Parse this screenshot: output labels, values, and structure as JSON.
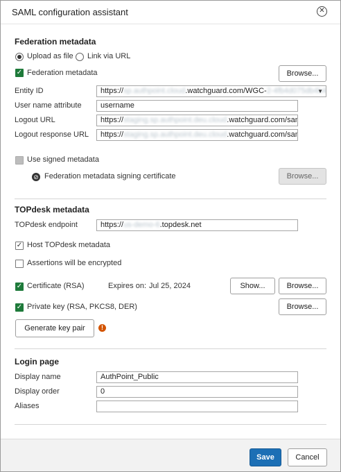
{
  "dialog": {
    "title": "SAML configuration assistant",
    "close_icon": "close-circle-icon"
  },
  "federation": {
    "section_title": "Federation metadata",
    "upload_label": "Upload as file",
    "link_label": "Link via URL",
    "metadata_checkbox_label": "Federation metadata",
    "browse_label": "Browse...",
    "entity_id_label": "Entity ID",
    "entity_id_prefix": "https://",
    "entity_id_blur1": "sp.authpoint.cloud",
    "entity_id_mid": ".watchguard.com/WGC-",
    "entity_id_blur2": "2-4fb4d075db4b4e",
    "username_attr_label": "User name attribute",
    "username_attr_value": "username",
    "logout_url_label": "Logout URL",
    "logout_url_prefix": "https://",
    "logout_url_blur": "staging.sp.authpoint.deu.cloud",
    "logout_url_suffix": ".watchguard.com/saml/l",
    "logout_resp_label": "Logout response URL",
    "logout_resp_prefix": "https://",
    "logout_resp_blur": "staging.sp.authpoint.deu.cloud",
    "logout_resp_suffix": ".watchguard.com/saml/l",
    "signed_metadata_label": "Use signed metadata",
    "signing_cert_label": "Federation metadata signing certificate",
    "signing_browse_label": "Browse..."
  },
  "topdesk": {
    "section_title": "TOPdesk metadata",
    "endpoint_label": "TOPdesk endpoint",
    "endpoint_prefix": "https://",
    "endpoint_blur": "us-demo-6",
    "endpoint_suffix": ".topdesk.net",
    "host_label": "Host TOPdesk metadata",
    "assertions_label": "Assertions will be encrypted",
    "certificate_label": "Certificate (RSA)",
    "expires_label": "Expires on:",
    "expires_value": "Jul 25, 2024",
    "show_label": "Show...",
    "cert_browse_label": "Browse...",
    "private_key_label": "Private key (RSA, PKCS8, DER)",
    "key_browse_label": "Browse...",
    "generate_label": "Generate key pair",
    "warning_glyph": "!"
  },
  "login": {
    "section_title": "Login page",
    "display_name_label": "Display name",
    "display_name_value": "AuthPoint_Public",
    "display_order_label": "Display order",
    "display_order_value": "0",
    "aliases_label": "Aliases",
    "aliases_value": ""
  },
  "footer": {
    "save_label": "Save",
    "cancel_label": "Cancel"
  },
  "colors": {
    "primary": "#1c6fb5",
    "checkbox_green": "#1e7a3a",
    "warning": "#d35400"
  }
}
